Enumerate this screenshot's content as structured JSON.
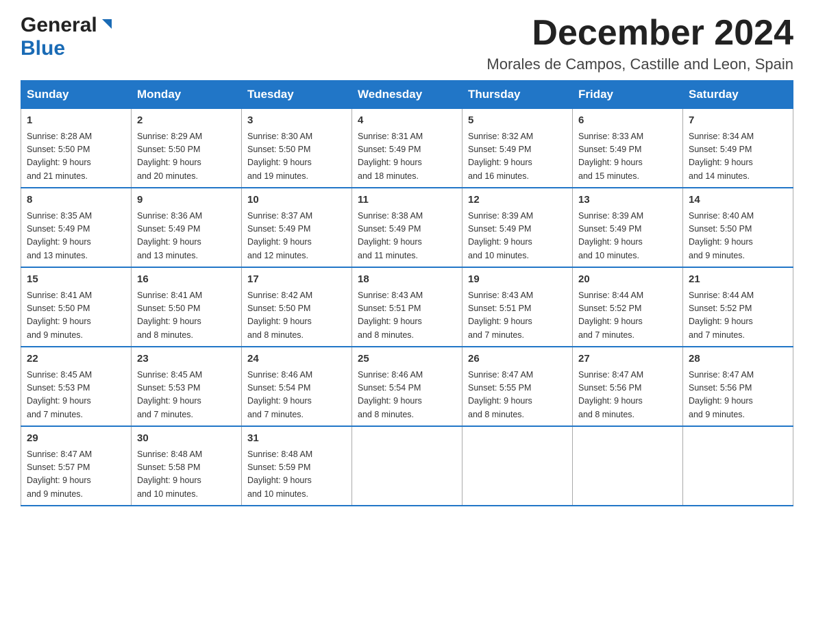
{
  "header": {
    "logo_general": "General",
    "logo_blue": "Blue",
    "month_title": "December 2024",
    "location": "Morales de Campos, Castille and Leon, Spain"
  },
  "days_of_week": [
    "Sunday",
    "Monday",
    "Tuesday",
    "Wednesday",
    "Thursday",
    "Friday",
    "Saturday"
  ],
  "weeks": [
    [
      {
        "day": "1",
        "sunrise": "8:28 AM",
        "sunset": "5:50 PM",
        "daylight": "9 hours and 21 minutes."
      },
      {
        "day": "2",
        "sunrise": "8:29 AM",
        "sunset": "5:50 PM",
        "daylight": "9 hours and 20 minutes."
      },
      {
        "day": "3",
        "sunrise": "8:30 AM",
        "sunset": "5:50 PM",
        "daylight": "9 hours and 19 minutes."
      },
      {
        "day": "4",
        "sunrise": "8:31 AM",
        "sunset": "5:49 PM",
        "daylight": "9 hours and 18 minutes."
      },
      {
        "day": "5",
        "sunrise": "8:32 AM",
        "sunset": "5:49 PM",
        "daylight": "9 hours and 16 minutes."
      },
      {
        "day": "6",
        "sunrise": "8:33 AM",
        "sunset": "5:49 PM",
        "daylight": "9 hours and 15 minutes."
      },
      {
        "day": "7",
        "sunrise": "8:34 AM",
        "sunset": "5:49 PM",
        "daylight": "9 hours and 14 minutes."
      }
    ],
    [
      {
        "day": "8",
        "sunrise": "8:35 AM",
        "sunset": "5:49 PM",
        "daylight": "9 hours and 13 minutes."
      },
      {
        "day": "9",
        "sunrise": "8:36 AM",
        "sunset": "5:49 PM",
        "daylight": "9 hours and 13 minutes."
      },
      {
        "day": "10",
        "sunrise": "8:37 AM",
        "sunset": "5:49 PM",
        "daylight": "9 hours and 12 minutes."
      },
      {
        "day": "11",
        "sunrise": "8:38 AM",
        "sunset": "5:49 PM",
        "daylight": "9 hours and 11 minutes."
      },
      {
        "day": "12",
        "sunrise": "8:39 AM",
        "sunset": "5:49 PM",
        "daylight": "9 hours and 10 minutes."
      },
      {
        "day": "13",
        "sunrise": "8:39 AM",
        "sunset": "5:49 PM",
        "daylight": "9 hours and 10 minutes."
      },
      {
        "day": "14",
        "sunrise": "8:40 AM",
        "sunset": "5:50 PM",
        "daylight": "9 hours and 9 minutes."
      }
    ],
    [
      {
        "day": "15",
        "sunrise": "8:41 AM",
        "sunset": "5:50 PM",
        "daylight": "9 hours and 9 minutes."
      },
      {
        "day": "16",
        "sunrise": "8:41 AM",
        "sunset": "5:50 PM",
        "daylight": "9 hours and 8 minutes."
      },
      {
        "day": "17",
        "sunrise": "8:42 AM",
        "sunset": "5:50 PM",
        "daylight": "9 hours and 8 minutes."
      },
      {
        "day": "18",
        "sunrise": "8:43 AM",
        "sunset": "5:51 PM",
        "daylight": "9 hours and 8 minutes."
      },
      {
        "day": "19",
        "sunrise": "8:43 AM",
        "sunset": "5:51 PM",
        "daylight": "9 hours and 7 minutes."
      },
      {
        "day": "20",
        "sunrise": "8:44 AM",
        "sunset": "5:52 PM",
        "daylight": "9 hours and 7 minutes."
      },
      {
        "day": "21",
        "sunrise": "8:44 AM",
        "sunset": "5:52 PM",
        "daylight": "9 hours and 7 minutes."
      }
    ],
    [
      {
        "day": "22",
        "sunrise": "8:45 AM",
        "sunset": "5:53 PM",
        "daylight": "9 hours and 7 minutes."
      },
      {
        "day": "23",
        "sunrise": "8:45 AM",
        "sunset": "5:53 PM",
        "daylight": "9 hours and 7 minutes."
      },
      {
        "day": "24",
        "sunrise": "8:46 AM",
        "sunset": "5:54 PM",
        "daylight": "9 hours and 7 minutes."
      },
      {
        "day": "25",
        "sunrise": "8:46 AM",
        "sunset": "5:54 PM",
        "daylight": "9 hours and 8 minutes."
      },
      {
        "day": "26",
        "sunrise": "8:47 AM",
        "sunset": "5:55 PM",
        "daylight": "9 hours and 8 minutes."
      },
      {
        "day": "27",
        "sunrise": "8:47 AM",
        "sunset": "5:56 PM",
        "daylight": "9 hours and 8 minutes."
      },
      {
        "day": "28",
        "sunrise": "8:47 AM",
        "sunset": "5:56 PM",
        "daylight": "9 hours and 9 minutes."
      }
    ],
    [
      {
        "day": "29",
        "sunrise": "8:47 AM",
        "sunset": "5:57 PM",
        "daylight": "9 hours and 9 minutes."
      },
      {
        "day": "30",
        "sunrise": "8:48 AM",
        "sunset": "5:58 PM",
        "daylight": "9 hours and 10 minutes."
      },
      {
        "day": "31",
        "sunrise": "8:48 AM",
        "sunset": "5:59 PM",
        "daylight": "9 hours and 10 minutes."
      },
      null,
      null,
      null,
      null
    ]
  ],
  "labels": {
    "sunrise": "Sunrise:",
    "sunset": "Sunset:",
    "daylight": "Daylight:"
  }
}
